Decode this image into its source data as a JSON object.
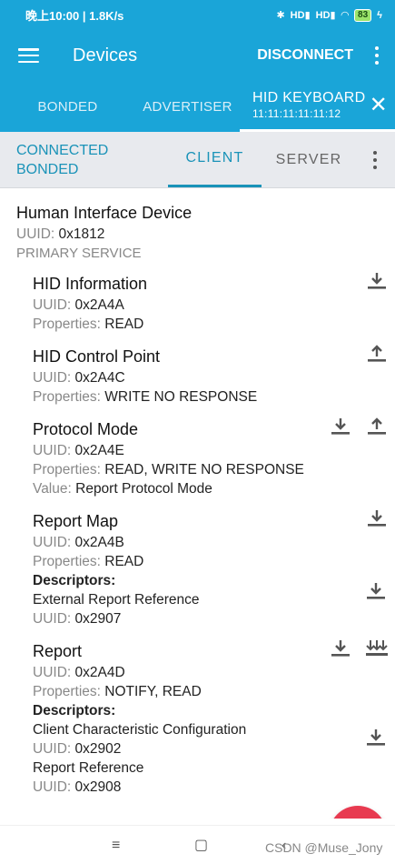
{
  "status_bar": {
    "time": "晚上10:00 | 1.8K/s",
    "signal_text": "HD",
    "battery": "83"
  },
  "app_bar": {
    "title": "Devices",
    "disconnect_label": "DISCONNECT"
  },
  "tabs": {
    "bonded": "BONDED",
    "advertiser": "ADVERTISER",
    "active_title": "HID KEYBOARD",
    "active_subtitle": "11:11:11:11:11:12"
  },
  "subbar": {
    "status_line1": "CONNECTED",
    "status_line2": "BONDED",
    "client": "CLIENT",
    "server": "SERVER"
  },
  "labels": {
    "uuid": "UUID:",
    "properties": "Properties:",
    "value": "Value:",
    "descriptors": "Descriptors:"
  },
  "service": {
    "name": "Human Interface Device",
    "uuid": "0x1812",
    "type": "PRIMARY SERVICE"
  },
  "characteristics": [
    {
      "name": "HID Information",
      "uuid": "0x2A4A",
      "properties": "READ"
    },
    {
      "name": "HID Control Point",
      "uuid": "0x2A4C",
      "properties": "WRITE NO RESPONSE"
    },
    {
      "name": "Protocol Mode",
      "uuid": "0x2A4E",
      "properties": "READ, WRITE NO RESPONSE",
      "value": "Report Protocol Mode"
    },
    {
      "name": "Report Map",
      "uuid": "0x2A4B",
      "properties": "READ",
      "descriptors": [
        {
          "name": "External Report Reference",
          "uuid": "0x2907"
        }
      ]
    },
    {
      "name": "Report",
      "uuid": "0x2A4D",
      "properties": "NOTIFY, READ",
      "descriptors": [
        {
          "name": "Client Characteristic Configuration",
          "uuid": "0x2902"
        },
        {
          "name": "Report Reference",
          "uuid": "0x2908"
        }
      ]
    }
  ],
  "watermark": "CSDN @Muse_Jony",
  "colors": {
    "primary": "#1aa5d8",
    "accent_text": "#1a93b8",
    "fab": "#e83a50",
    "subbar_bg": "#e8eaee"
  }
}
